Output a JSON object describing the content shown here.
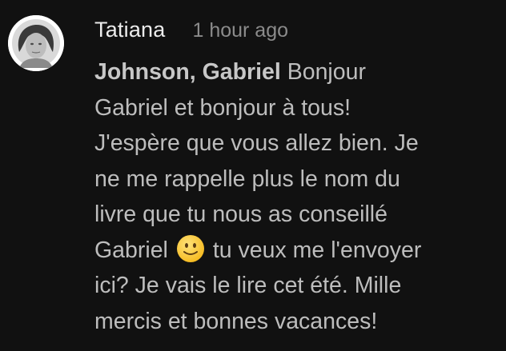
{
  "comment": {
    "author": "Tatiana",
    "time": "1 hour ago",
    "mention": "Johnson, Gabriel",
    "text_lines": [
      "Bonjour",
      "Gabriel et bonjour à tous!",
      "J'espère que vous allez bien. Je",
      "ne me rappelle plus le nom du",
      "livre que tu nous as conseillé",
      "Gabriel",
      "tu veux me l'envoyer",
      "ici? Je vais le lire cet été. Mille",
      "mercis et bonnes vacances!"
    ],
    "emoji": "slightly-smiling-face",
    "colors": {
      "background": "#111111",
      "author": "#ececec",
      "time": "#8b8b8b",
      "text": "#bdbdbd",
      "emoji": "#f5c518"
    }
  }
}
